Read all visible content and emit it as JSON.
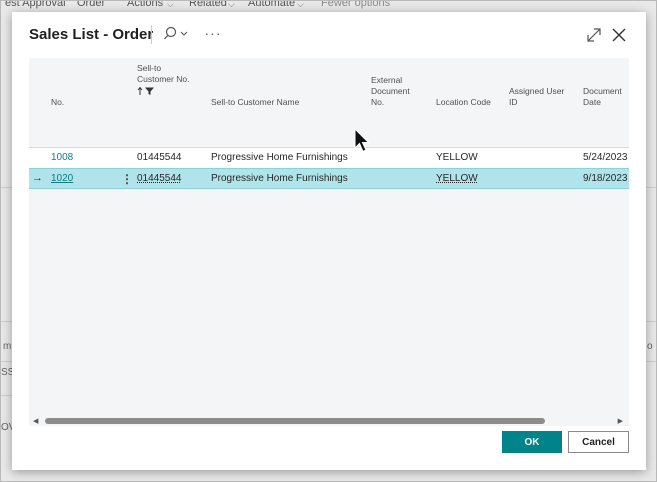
{
  "background": {
    "toolbar_items": [
      "est Approval",
      "Order",
      "Actions",
      "Related",
      "Automate",
      "Fewer options"
    ],
    "left_fragments": [
      "m",
      "SS",
      "OV"
    ],
    "right_fragments": [
      "o"
    ]
  },
  "dialog": {
    "title": "Sales List - Order",
    "more_label": "···",
    "ok_label": "OK",
    "cancel_label": "Cancel"
  },
  "columns": {
    "no": "No.",
    "sell_to_no_line1": "Sell-to",
    "sell_to_no_line2": "Customer No.",
    "sell_to_name": "Sell-to Customer Name",
    "ext_doc_line1": "External",
    "ext_doc_line2": "Document",
    "ext_doc_line3": "No.",
    "location": "Location Code",
    "assigned_line1": "Assigned User",
    "assigned_line2": "ID",
    "doc_date_line1": "Document",
    "doc_date_line2": "Date"
  },
  "rows": [
    {
      "no": "1008",
      "customer_no": "01445544",
      "customer_name": "Progressive Home Furnishings",
      "external_doc": "",
      "location": "YELLOW",
      "assigned_user": "",
      "doc_date": "5/24/2023"
    },
    {
      "no": "1020",
      "customer_no": "01445544",
      "customer_name": "Progressive Home Furnishings",
      "external_doc": "",
      "location": "YELLOW",
      "assigned_user": "",
      "doc_date": "9/18/2023"
    }
  ],
  "selected_row_arrow": "→",
  "row_menu": "⋮",
  "icons": {
    "search": "search-icon",
    "chevron": "chevron-down-icon",
    "expand": "expand-icon",
    "close": "close-icon",
    "sort": "sort-ascending-icon",
    "filter": "filter-icon",
    "cursor": "mouse-pointer-icon"
  },
  "colors": {
    "accent": "#008489",
    "link": "#0e7e82",
    "selected_row": "#b1e4ea"
  }
}
